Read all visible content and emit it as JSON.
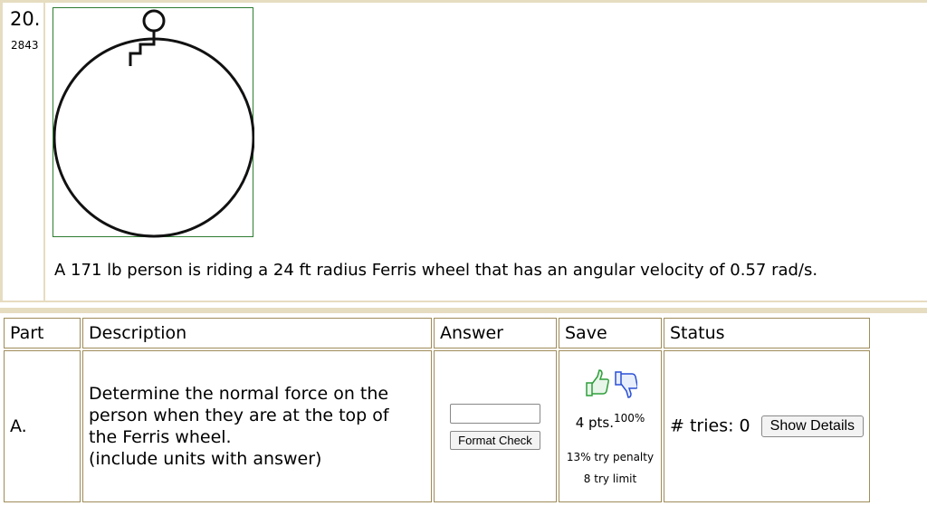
{
  "problem": {
    "number": "20.",
    "id": "2843",
    "text": "A 171 lb person is riding a 24 ft radius Ferris wheel that has an angular velocity of 0.57 rad/s."
  },
  "table": {
    "headers": [
      "Part",
      "Description",
      "Answer",
      "Save",
      "Status"
    ],
    "rows": [
      {
        "part": "A.",
        "description": [
          "Determine the normal force on the",
          "person when they are at the top of",
          "the Ferris wheel.",
          "(include units with answer)"
        ],
        "answer_value": "",
        "format_button": "Format Check",
        "points": "4 pts.",
        "points_pct": "100%",
        "penalty": "13% try penalty",
        "limit": "8 try limit",
        "tries_label": "# tries: 0",
        "details_button": "Show Details"
      }
    ]
  },
  "icons": {
    "thumbs_up": "thumbs-up-icon",
    "thumbs_down": "thumbs-down-icon"
  },
  "colors": {
    "border": "#a08c5a",
    "frame": "#e6dcc0",
    "figure_border": "#2e7d32",
    "thumb_up": "#2e9e3a",
    "thumb_down": "#2a4fd6"
  }
}
